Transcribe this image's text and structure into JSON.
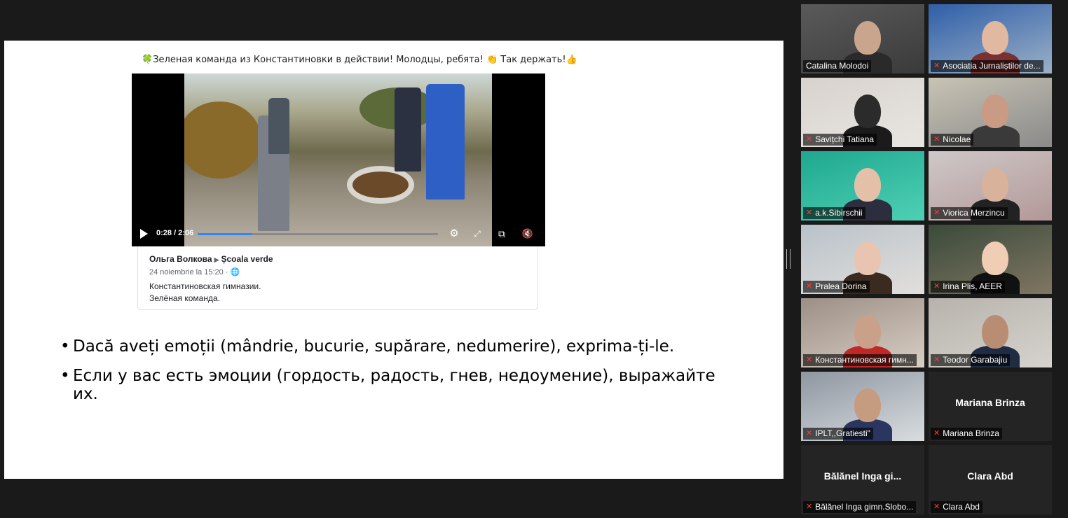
{
  "slide": {
    "fb_caption_prefix": "🍀",
    "fb_caption": "Зеленая команда из Константиновки в действии! Молодцы, ребята! 👏 Так держать!👍",
    "video": {
      "time": "0:28 / 2:06",
      "progress_fraction": 0.226
    },
    "post": {
      "author": "Ольга Волкова",
      "group": "Școala verde",
      "date": "24 noiembrie la 15:20 · 🌐",
      "line1": "Константиновская гимназии.",
      "line2": "Зелёная команда."
    },
    "bullets": [
      "Dacă aveți emoții (mândrie, bucurie, supărare, nedumerire), exprima-ți-le.",
      "Если у вас есть эмоции (гордость, радость, гнев, недоумение), выражайте их."
    ]
  },
  "participants": [
    {
      "name": "Catalina Molodoi",
      "muted": false,
      "active": true,
      "video": true
    },
    {
      "name": "Asociatia Jurnaliștilor de...",
      "muted": true,
      "active": false,
      "video": true
    },
    {
      "name": "Savițchi Tatiana",
      "muted": true,
      "active": false,
      "video": true
    },
    {
      "name": "Nicolae",
      "muted": true,
      "active": false,
      "video": true
    },
    {
      "name": "a.k.Sibirschii",
      "muted": true,
      "active": false,
      "video": true
    },
    {
      "name": "Viorica Merzincu",
      "muted": true,
      "active": false,
      "video": true
    },
    {
      "name": "Pralea Dorina",
      "muted": true,
      "active": false,
      "video": true
    },
    {
      "name": "Irina Plis, AEER",
      "muted": true,
      "active": false,
      "video": true
    },
    {
      "name": "Константиновская гимн...",
      "muted": true,
      "active": false,
      "video": true
    },
    {
      "name": "Teodor Garabajiu",
      "muted": true,
      "active": false,
      "video": true
    },
    {
      "name": "IPLT,,Gratiesti\"",
      "muted": true,
      "active": false,
      "video": true
    },
    {
      "name": "Mariana Brinza",
      "display_name": "Mariana Brinza",
      "muted": true,
      "active": false,
      "video": false
    },
    {
      "name": "Bălănel Inga gimn.Slobo...",
      "display_name": "Bălănel Inga gi...",
      "muted": true,
      "active": false,
      "video": false
    },
    {
      "name": "Clara Abd",
      "display_name": "Clara Abd",
      "muted": true,
      "active": false,
      "video": false
    }
  ]
}
